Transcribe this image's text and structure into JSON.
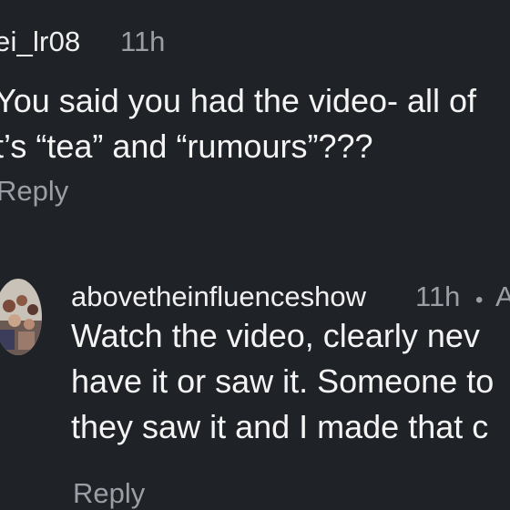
{
  "comments": [
    {
      "username": "ei_lr08",
      "time": "11h",
      "lines": [
        "You said you had the video- all of",
        "t’s “tea” and “rumours”???"
      ],
      "reply_label": "Reply"
    },
    {
      "username": "abovetheinfluenceshow",
      "time": "11h",
      "separator": "•",
      "extra": "A",
      "lines": [
        "Watch the video, clearly nev",
        "have it or saw it. Someone to",
        "they saw it and I made that c"
      ],
      "reply_label": "Reply",
      "avatar": "avatar-photo-icon"
    }
  ],
  "colors": {
    "background": "#1f2227",
    "primary_text": "#f4f4f4",
    "secondary_text": "#9a9ea5"
  }
}
